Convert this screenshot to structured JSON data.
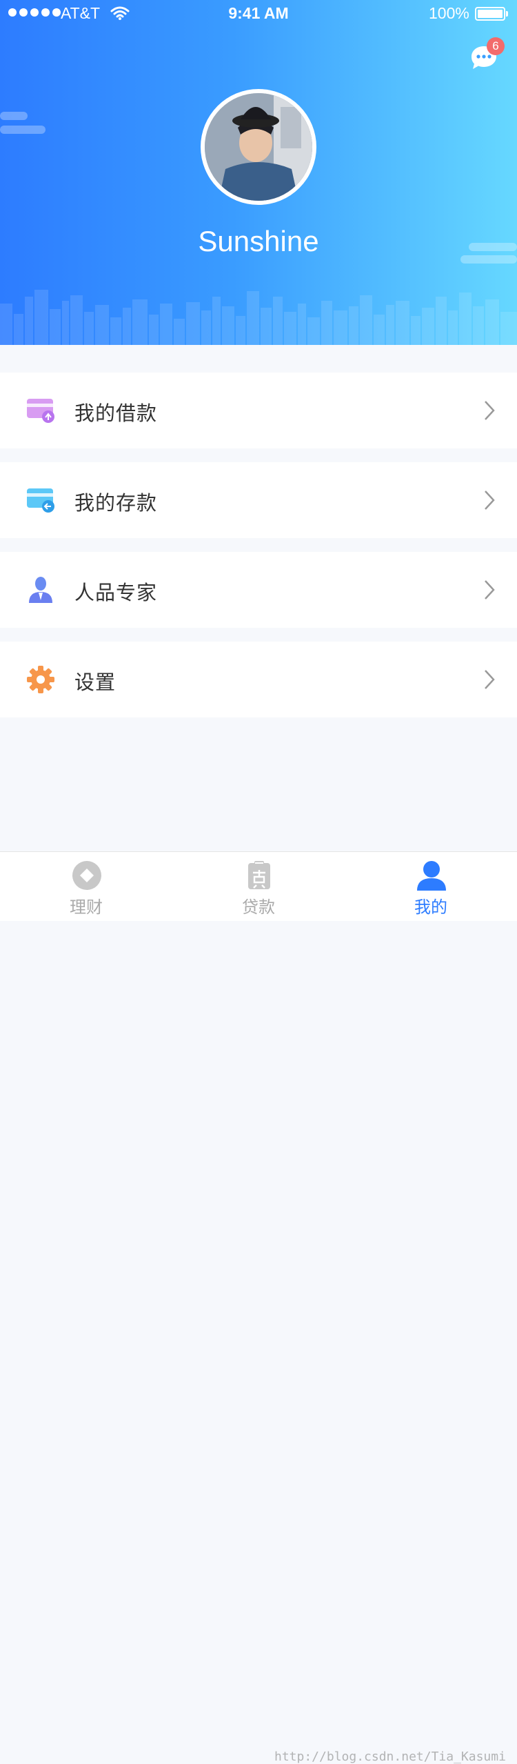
{
  "status_bar": {
    "carrier": "AT&T",
    "time": "9:41 AM",
    "battery": "100%"
  },
  "header": {
    "message_badge": "6",
    "username": "Sunshine"
  },
  "menu": [
    {
      "label": "我的借款",
      "icon": "loan-card-icon"
    },
    {
      "label": "我的存款",
      "icon": "deposit-card-icon"
    },
    {
      "label": "人品专家",
      "icon": "expert-person-icon"
    },
    {
      "label": "设置",
      "icon": "settings-gear-icon"
    }
  ],
  "tabs": [
    {
      "label": "理财",
      "icon": "finance-icon",
      "active": false
    },
    {
      "label": "贷款",
      "icon": "loan-icon",
      "active": false
    },
    {
      "label": "我的",
      "icon": "profile-icon",
      "active": true
    }
  ],
  "watermark": "http://blog.csdn.net/Tia_Kasumi",
  "colors": {
    "accent": "#2d7cff",
    "badge": "#f26b6b"
  }
}
